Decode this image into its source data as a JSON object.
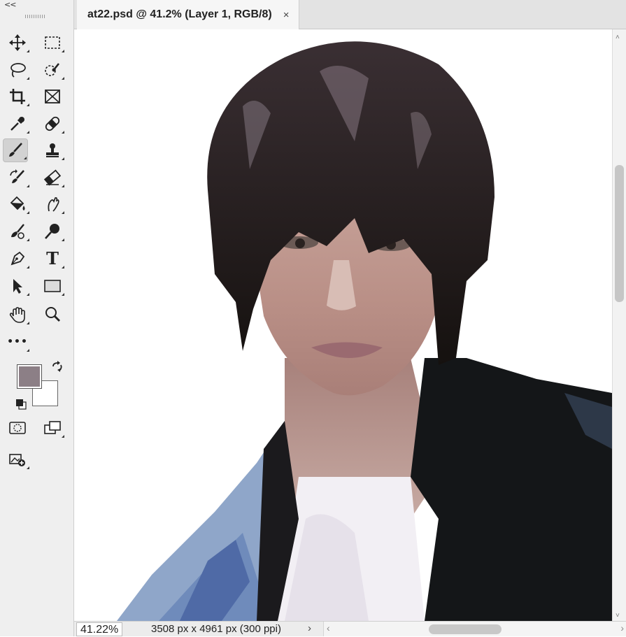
{
  "toolbar": {
    "collapse_label": "<<",
    "tools": [
      {
        "name": "move-tool",
        "icon": "move-icon"
      },
      {
        "name": "marquee-tool",
        "icon": "rect-marquee-icon"
      },
      {
        "name": "lasso-tool",
        "icon": "lasso-icon"
      },
      {
        "name": "quick-select-tool",
        "icon": "quick-select-icon"
      },
      {
        "name": "crop-tool",
        "icon": "crop-icon"
      },
      {
        "name": "frame-tool",
        "icon": "frame-icon"
      },
      {
        "name": "eyedropper-tool",
        "icon": "eyedropper-icon"
      },
      {
        "name": "healing-tool",
        "icon": "bandage-icon"
      },
      {
        "name": "brush-tool",
        "icon": "brush-icon",
        "active": true
      },
      {
        "name": "stamp-tool",
        "icon": "stamp-icon"
      },
      {
        "name": "history-brush-tool",
        "icon": "history-brush-icon"
      },
      {
        "name": "eraser-tool",
        "icon": "eraser-icon"
      },
      {
        "name": "paint-bucket-tool",
        "icon": "paint-bucket-icon"
      },
      {
        "name": "smudge-tool",
        "icon": "smudge-icon"
      },
      {
        "name": "burn-tool",
        "icon": "burn-icon"
      },
      {
        "name": "dodge-tool",
        "icon": "dodge-icon"
      },
      {
        "name": "pen-tool",
        "icon": "pen-icon"
      },
      {
        "name": "type-tool",
        "icon": "type-icon",
        "glyph": "T"
      },
      {
        "name": "path-select-tool",
        "icon": "arrow-icon"
      },
      {
        "name": "rectangle-tool",
        "icon": "rectangle-icon"
      },
      {
        "name": "hand-tool",
        "icon": "hand-icon"
      },
      {
        "name": "zoom-tool",
        "icon": "magnifier-icon"
      },
      {
        "name": "more-tools",
        "icon": "ellipsis-icon",
        "glyph": "•••"
      }
    ],
    "foreground_color": "#8c7f86",
    "background_color": "#ffffff"
  },
  "document": {
    "tab_title": "at22.psd @ 41.2% (Layer 1, RGB/8)",
    "close_glyph": "×"
  },
  "status": {
    "zoom": "41.22%",
    "doc_info": "3508 px x 4961 px (300 ppi)",
    "arrow": "›"
  },
  "scrollbars": {
    "up": "˄",
    "down": "˅",
    "left": "‹",
    "right": "›"
  }
}
